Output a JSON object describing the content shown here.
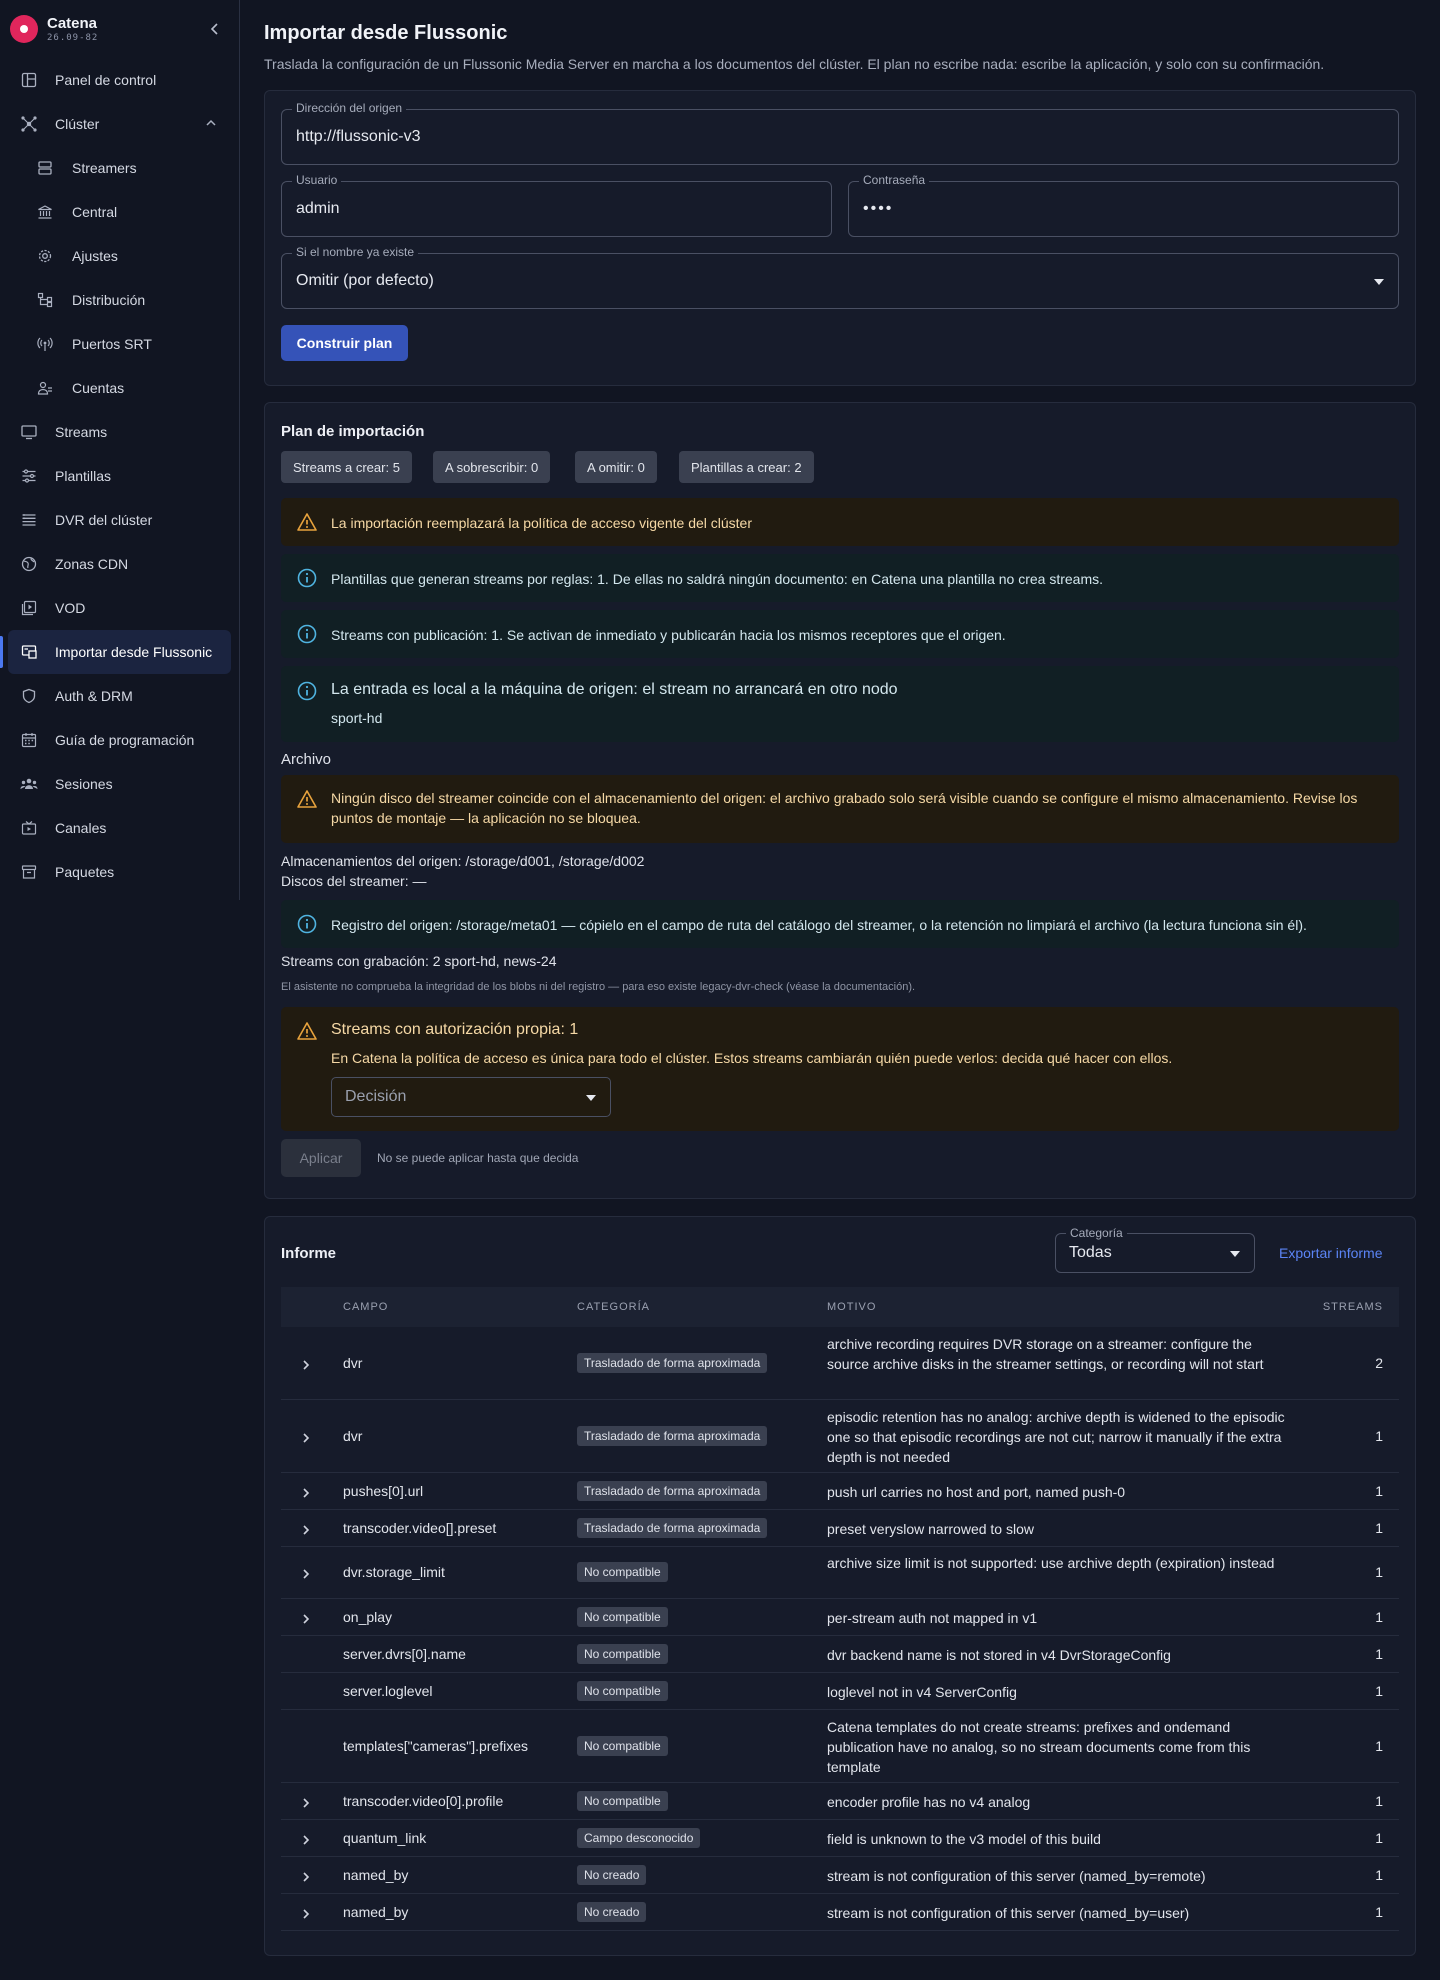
{
  "brand": {
    "name": "Catena",
    "version": "26.09-82"
  },
  "sidebar": {
    "items": [
      {
        "label": "Panel de control",
        "icon": "dashboard-icon"
      },
      {
        "label": "Clúster",
        "icon": "cluster-icon"
      },
      {
        "label": "Streamers",
        "icon": "server-icon"
      },
      {
        "label": "Central",
        "icon": "bank-icon"
      },
      {
        "label": "Ajustes",
        "icon": "gear-icon"
      },
      {
        "label": "Distribución",
        "icon": "distribution-icon"
      },
      {
        "label": "Puertos SRT",
        "icon": "antenna-icon"
      },
      {
        "label": "Cuentas",
        "icon": "accounts-icon"
      },
      {
        "label": "Streams",
        "icon": "monitor-icon"
      },
      {
        "label": "Plantillas",
        "icon": "sliders-icon"
      },
      {
        "label": "DVR del clúster",
        "icon": "storage-icon"
      },
      {
        "label": "Zonas CDN",
        "icon": "globe-icon"
      },
      {
        "label": "VOD",
        "icon": "vod-icon"
      },
      {
        "label": "Importar desde Flussonic",
        "icon": "import-icon"
      },
      {
        "label": "Auth & DRM",
        "icon": "shield-icon"
      },
      {
        "label": "Guía de programación",
        "icon": "calendar-icon"
      },
      {
        "label": "Sesiones",
        "icon": "sessions-icon"
      },
      {
        "label": "Canales",
        "icon": "channel-icon"
      },
      {
        "label": "Paquetes",
        "icon": "package-icon"
      }
    ]
  },
  "page": {
    "title": "Importar desde Flussonic",
    "subtitle": "Traslada la configuración de un Flussonic Media Server en marcha a los documentos del clúster. El plan no escribe nada: escribe la aplicación, y solo con su confirmación."
  },
  "form": {
    "origin_label": "Dirección del origen",
    "origin_value": "http://flussonic-v3",
    "user_label": "Usuario",
    "user_value": "admin",
    "password_label": "Contraseña",
    "password_value": "••••",
    "conflict_label": "Si el nombre ya existe",
    "conflict_value": "Omitir (por defecto)",
    "build_button": "Construir plan"
  },
  "plan": {
    "title": "Plan de importación",
    "chips": [
      "Streams a crear: 5",
      "A sobrescribir: 0",
      "A omitir: 0",
      "Plantillas a crear: 2"
    ],
    "alert_policy": "La importación reemplazará la política de acceso vigente del clúster",
    "alert_templates": "Plantillas que generan streams por reglas: 1. De ellas no saldrá ningún documento: en Catena una plantilla no crea streams.",
    "alert_publish": "Streams con publicación: 1. Se activan de inmediato y publicarán hacia los mismos receptores que el origen.",
    "alert_local_title": "La entrada es local a la máquina de origen: el stream no arrancará en otro nodo",
    "alert_local_stream": "sport-hd",
    "archive_title": "Archivo",
    "alert_disk": "Ningún disco del streamer coincide con el almacenamiento del origen: el archivo grabado solo será visible cuando se configure el mismo almacenamiento. Revise los puntos de montaje — la aplicación no se bloquea.",
    "origin_storage": "Almacenamientos del origen: /storage/d001, /storage/d002",
    "streamer_disks": "Discos del streamer: —",
    "alert_registry": "Registro del origen: /storage/meta01 — cópielo en el campo de ruta del catálogo del streamer, o la retención no limpiará el archivo (la lectura funciona sin él).",
    "recording_streams": "Streams con grabación: 2 sport-hd, news-24",
    "integrity_note": "El asistente no comprueba la integridad de los blobs ni del registro — para eso existe legacy-dvr-check (véase la documentación).",
    "auth_title": "Streams con autorización propia: 1",
    "auth_text": "En Catena la política de acceso es única para todo el clúster. Estos streams cambiarán quién puede verlos: decida qué hacer con ellos.",
    "decision_placeholder": "Decisión",
    "apply_button": "Aplicar",
    "apply_hint": "No se puede aplicar hasta que decida"
  },
  "report": {
    "title": "Informe",
    "category_label": "Categoría",
    "category_value": "Todas",
    "export_link": "Exportar informe",
    "columns": [
      "CAMPO",
      "CATEGORÍA",
      "MOTIVO",
      "STREAMS"
    ],
    "rows": [
      {
        "campo": "dvr",
        "categoria": "Trasladado de forma aproximada",
        "motivo": "archive recording requires DVR storage on a streamer: configure the source archive disks in the streamer settings, or recording will not start",
        "streams": "2",
        "expandable": true
      },
      {
        "campo": "dvr",
        "categoria": "Trasladado de forma aproximada",
        "motivo": "episodic retention has no analog: archive depth is widened to the episodic one so that episodic recordings are not cut; narrow it manually if the extra depth is not needed",
        "streams": "1",
        "expandable": true
      },
      {
        "campo": "pushes[0].url",
        "categoria": "Trasladado de forma aproximada",
        "motivo": "push url carries no host and port, named push-0",
        "streams": "1",
        "expandable": true
      },
      {
        "campo": "transcoder.video[].preset",
        "categoria": "Trasladado de forma aproximada",
        "motivo": "preset veryslow narrowed to slow",
        "streams": "1",
        "expandable": true
      },
      {
        "campo": "dvr.storage_limit",
        "categoria": "No compatible",
        "motivo": "archive size limit is not supported: use archive depth (expiration) instead",
        "streams": "1",
        "expandable": true
      },
      {
        "campo": "on_play",
        "categoria": "No compatible",
        "motivo": "per-stream auth not mapped in v1",
        "streams": "1",
        "expandable": true
      },
      {
        "campo": "server.dvrs[0].name",
        "categoria": "No compatible",
        "motivo": "dvr backend name is not stored in v4 DvrStorageConfig",
        "streams": "1",
        "expandable": false
      },
      {
        "campo": "server.loglevel",
        "categoria": "No compatible",
        "motivo": "loglevel not in v4 ServerConfig",
        "streams": "1",
        "expandable": false
      },
      {
        "campo": "templates[\"cameras\"].prefixes",
        "categoria": "No compatible",
        "motivo": "Catena templates do not create streams: prefixes and ondemand publication have no analog, so no stream documents come from this template",
        "streams": "1",
        "expandable": false
      },
      {
        "campo": "transcoder.video[0].profile",
        "categoria": "No compatible",
        "motivo": "encoder profile has no v4 analog",
        "streams": "1",
        "expandable": true
      },
      {
        "campo": "quantum_link",
        "categoria": "Campo desconocido",
        "motivo": "field is unknown to the v3 model of this build",
        "streams": "1",
        "expandable": true
      },
      {
        "campo": "named_by",
        "categoria": "No creado",
        "motivo": "stream is not configuration of this server (named_by=remote)",
        "streams": "1",
        "expandable": true
      },
      {
        "campo": "named_by",
        "categoria": "No creado",
        "motivo": "stream is not configuration of this server (named_by=user)",
        "streams": "1",
        "expandable": true
      }
    ]
  },
  "colors": {
    "accent": "#3553b8",
    "warn": "#e8a33d",
    "info": "#4fb3e0",
    "brand": "#e0265c"
  }
}
